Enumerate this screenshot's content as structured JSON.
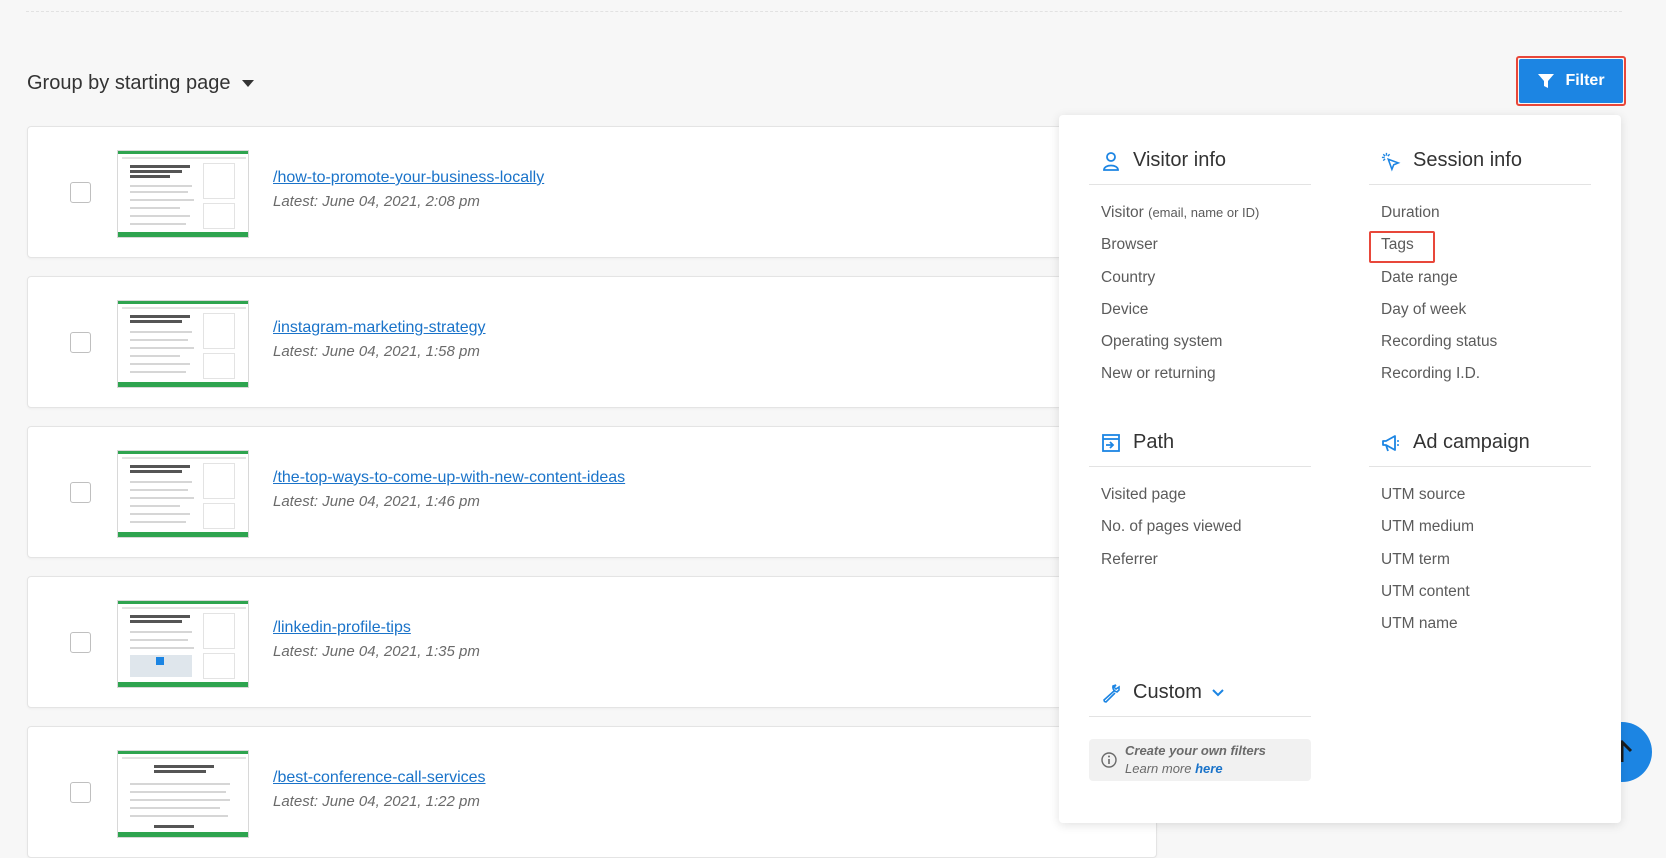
{
  "header": {
    "group_by_label": "Group by starting page",
    "filter_label": "Filter"
  },
  "recordings": [
    {
      "path": "/how-to-promote-your-business-locally",
      "latest": "Latest: June 04, 2021, 2:08 pm"
    },
    {
      "path": "/instagram-marketing-strategy",
      "latest": "Latest: June 04, 2021, 1:58 pm"
    },
    {
      "path": "/the-top-ways-to-come-up-with-new-content-ideas",
      "latest": "Latest: June 04, 2021, 1:46 pm"
    },
    {
      "path": "/linkedin-profile-tips",
      "latest": "Latest: June 04, 2021, 1:35 pm"
    },
    {
      "path": "/best-conference-call-services",
      "latest": "Latest: June 04, 2021, 1:22 pm"
    }
  ],
  "filter_panel": {
    "visitor_info": {
      "title": "Visitor info",
      "icon": "user-icon",
      "visitor_label": "Visitor",
      "visitor_hint": "(email, name or ID)",
      "items": [
        "Browser",
        "Country",
        "Device",
        "Operating system",
        "New or returning"
      ]
    },
    "session_info": {
      "title": "Session info",
      "icon": "cursor-click-icon",
      "items": [
        "Duration",
        "Tags",
        "Date range",
        "Day of week",
        "Recording status",
        "Recording I.D."
      ]
    },
    "path": {
      "title": "Path",
      "icon": "path-icon",
      "items": [
        "Visited page",
        "No. of pages viewed",
        "Referrer"
      ]
    },
    "ad_campaign": {
      "title": "Ad campaign",
      "icon": "megaphone-icon",
      "items": [
        "UTM source",
        "UTM medium",
        "UTM term",
        "UTM content",
        "UTM name"
      ]
    },
    "custom": {
      "title": "Custom",
      "icon": "wrench-icon",
      "note_line1": "Create your own filters",
      "note_line2": "Learn more",
      "note_link": "here"
    }
  },
  "colors": {
    "accent": "#1c85e3",
    "highlight": "#e8473a",
    "link": "#1a73c9"
  }
}
